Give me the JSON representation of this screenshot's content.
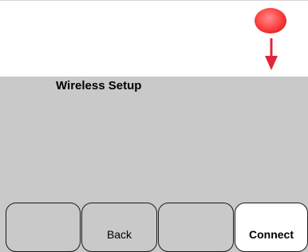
{
  "screen": {
    "title": "Wireless Setup"
  },
  "indicator": {
    "led_icon": "red-led-icon",
    "led_color": "#ff4a4a",
    "arrow_icon": "down-arrow-icon",
    "arrow_color": "#e0243a"
  },
  "softkeys": [
    {
      "label": ""
    },
    {
      "label": "Back"
    },
    {
      "label": ""
    },
    {
      "label": "Connect",
      "highlighted": true
    }
  ],
  "colors": {
    "screen_background": "#c9c9c9",
    "highlight_key_background": "#ffffff"
  }
}
